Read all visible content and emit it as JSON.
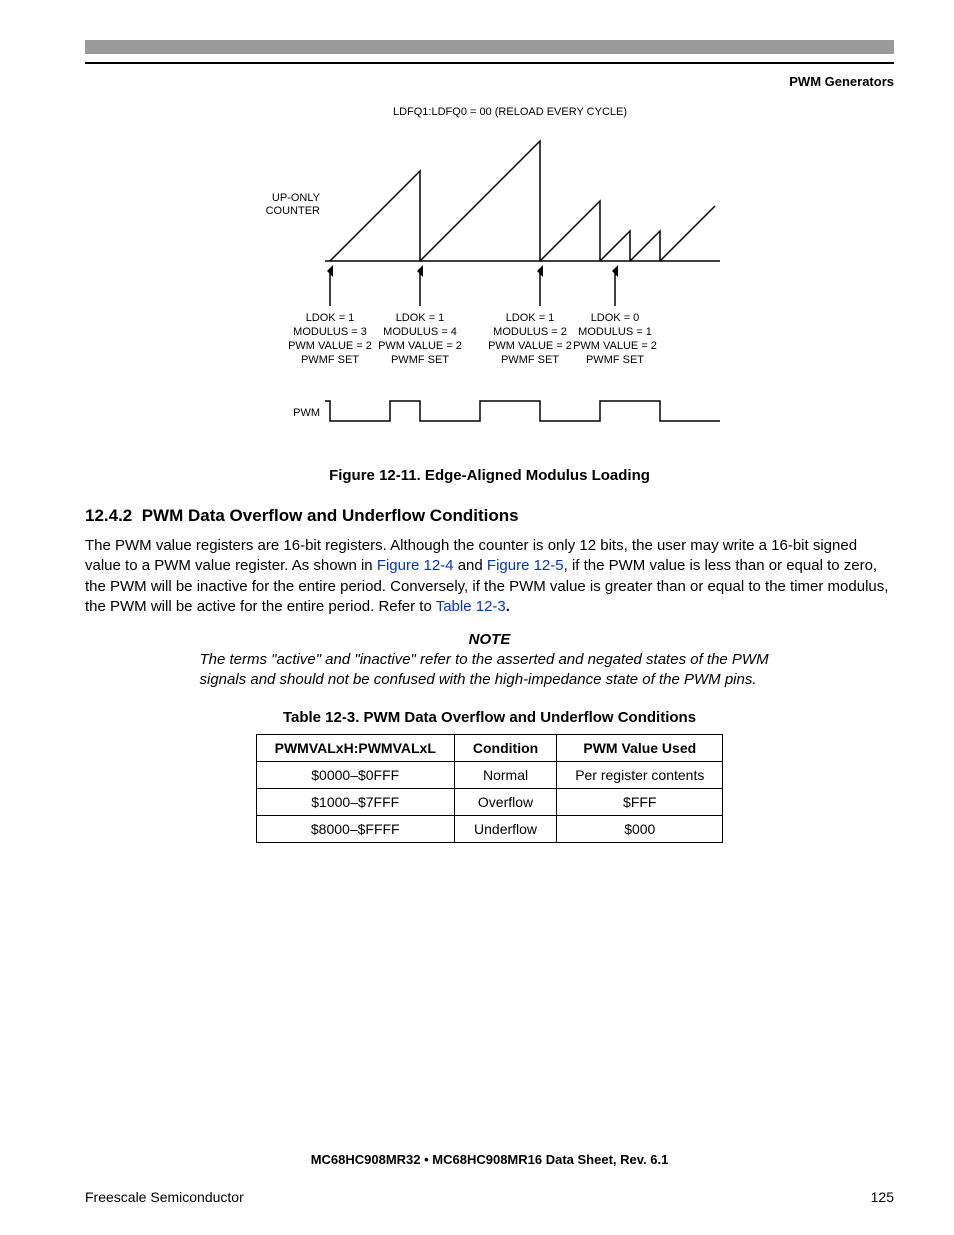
{
  "header": {
    "running": "PWM Generators"
  },
  "figure": {
    "top_label": "LDFQ1:LDFQ0 = 00 (RELOAD EVERY CYCLE)",
    "counter_label_1": "UP-ONLY",
    "counter_label_2": "COUNTER",
    "pwm_label": "PWM",
    "groups": [
      {
        "l1": "LDOK = 1",
        "l2": "MODULUS = 3",
        "l3": "PWM VALUE = 2",
        "l4": "PWMF SET"
      },
      {
        "l1": "LDOK = 1",
        "l2": "MODULUS = 4",
        "l3": "PWM VALUE = 2",
        "l4": "PWMF SET"
      },
      {
        "l1": "LDOK = 1",
        "l2": "MODULUS = 2",
        "l3": "PWM VALUE = 2",
        "l4": "PWMF SET"
      },
      {
        "l1": "LDOK = 0",
        "l2": "MODULUS = 1",
        "l3": "PWM VALUE = 2",
        "l4": "PWMF SET"
      }
    ],
    "caption": "Figure 12-11. Edge-Aligned Modulus Loading"
  },
  "section": {
    "number": "12.4.2",
    "title": "PWM Data Overflow and Underflow Conditions",
    "para_pre": "The PWM value registers are 16-bit registers. Although the counter is only 12 bits, the user may write a 16-bit signed value to a PWM value register. As shown in ",
    "xref1": "Figure 12-4",
    "para_mid": " and ",
    "xref2": "Figure 12-5",
    "para_post1": ", if the PWM value is less than or equal to zero, the PWM will be inactive for the entire period. Conversely, if the PWM value is greater than or equal to the timer modulus, the PWM will be active for the entire period. Refer to ",
    "xref3": "Table 12-3",
    "para_end": "."
  },
  "note": {
    "head": "NOTE",
    "body": "The terms \"active\" and \"inactive\" refer to the asserted and negated states of the PWM signals and should not be confused with the high-impedance state of the PWM pins."
  },
  "table": {
    "caption": "Table 12-3. PWM Data Overflow and Underflow Conditions",
    "headers": [
      "PWMVALxH:PWMVALxL",
      "Condition",
      "PWM Value Used"
    ],
    "rows": [
      [
        "$0000–$0FFF",
        "Normal",
        "Per register contents"
      ],
      [
        "$1000–$7FFF",
        "Overflow",
        "$FFF"
      ],
      [
        "$8000–$FFFF",
        "Underflow",
        "$000"
      ]
    ]
  },
  "footer": {
    "docline": "MC68HC908MR32 • MC68HC908MR16 Data Sheet, Rev. 6.1",
    "left": "Freescale Semiconductor",
    "right": "125"
  }
}
